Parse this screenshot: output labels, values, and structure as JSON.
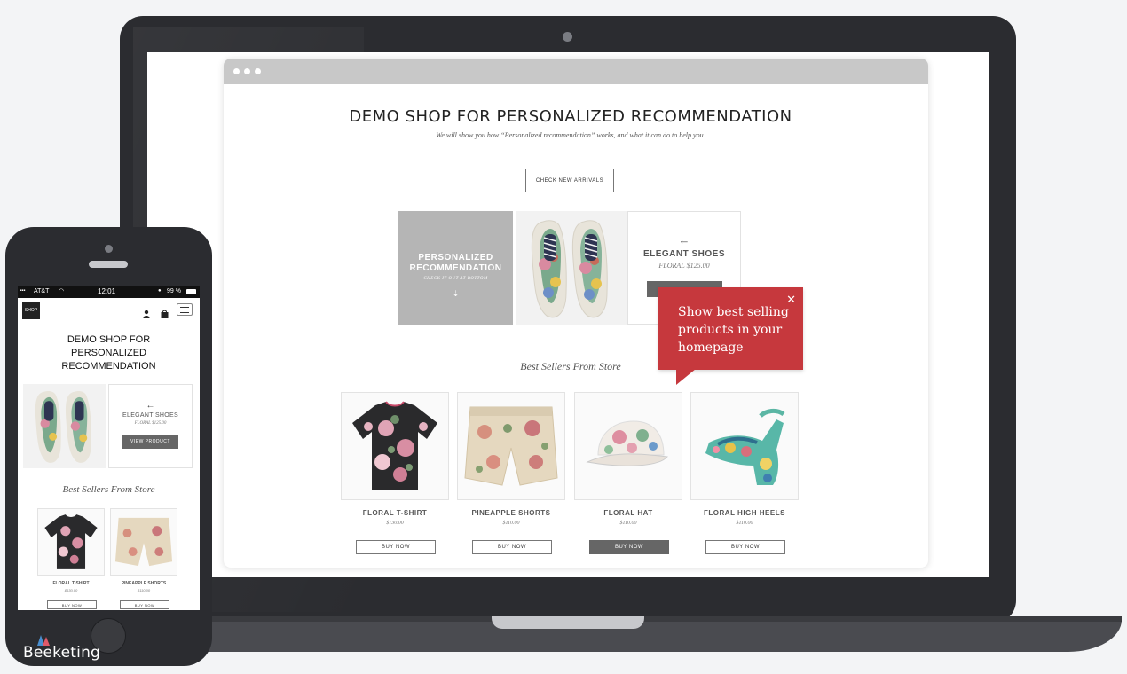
{
  "desktop": {
    "title": "DEMO SHOP FOR PERSONALIZED RECOMMENDATION",
    "subtitle": "We will show you how “Personalized recommendation” works, and what it can do to help you.",
    "cta_label": "CHECK NEW ARRIVALS",
    "promo": {
      "heading_line1": "PERSONALIZED",
      "heading_line2": "RECOMMENDATION",
      "sub": "CHECK IT OUT AT BOTTOM",
      "down_arrow": "⇣"
    },
    "featured": {
      "arrow": "←",
      "name": "ELEGANT SHOES",
      "price": "FLORAL $125.00"
    },
    "section_title": "Best Sellers From Store",
    "products": [
      {
        "name": "FLORAL T-SHIRT",
        "price": "$130.00",
        "button": "BUY NOW"
      },
      {
        "name": "PINEAPPLE SHORTS",
        "price": "$110.00",
        "button": "BUY NOW"
      },
      {
        "name": "FLORAL HAT",
        "price": "$110.00",
        "button": "BUY NOW"
      },
      {
        "name": "FLORAL HIGH HEELS",
        "price": "$110.00",
        "button": "BUY NOW"
      }
    ],
    "tooltip": {
      "text": "Show best selling products in your homepage",
      "close": "✕"
    }
  },
  "mobile": {
    "status": {
      "carrier": "AT&T",
      "time": "12:01",
      "battery": "99 %"
    },
    "logo": "SHOP",
    "title_line1": "DEMO SHOP FOR",
    "title_line2": "PERSONALIZED",
    "title_line3": "RECOMMENDATION",
    "featured": {
      "arrow": "←",
      "name": "ELEGANT SHOES",
      "price": "FLORAL $125.00",
      "button": "VIEW PRODUCT"
    },
    "section_title": "Best Sellers From Store",
    "products": [
      {
        "name": "FLORAL T-SHIRT",
        "price": "$130.00",
        "button": "BUY NOW"
      },
      {
        "name": "PINEAPPLE SHORTS",
        "price": "$110.00",
        "button": "BUY NOW"
      }
    ]
  },
  "branding": {
    "name": "Beeketing"
  },
  "colors": {
    "tooltip": "#c6383d",
    "device": "#2b2c30",
    "promo_gray": "#b5b5b5"
  }
}
